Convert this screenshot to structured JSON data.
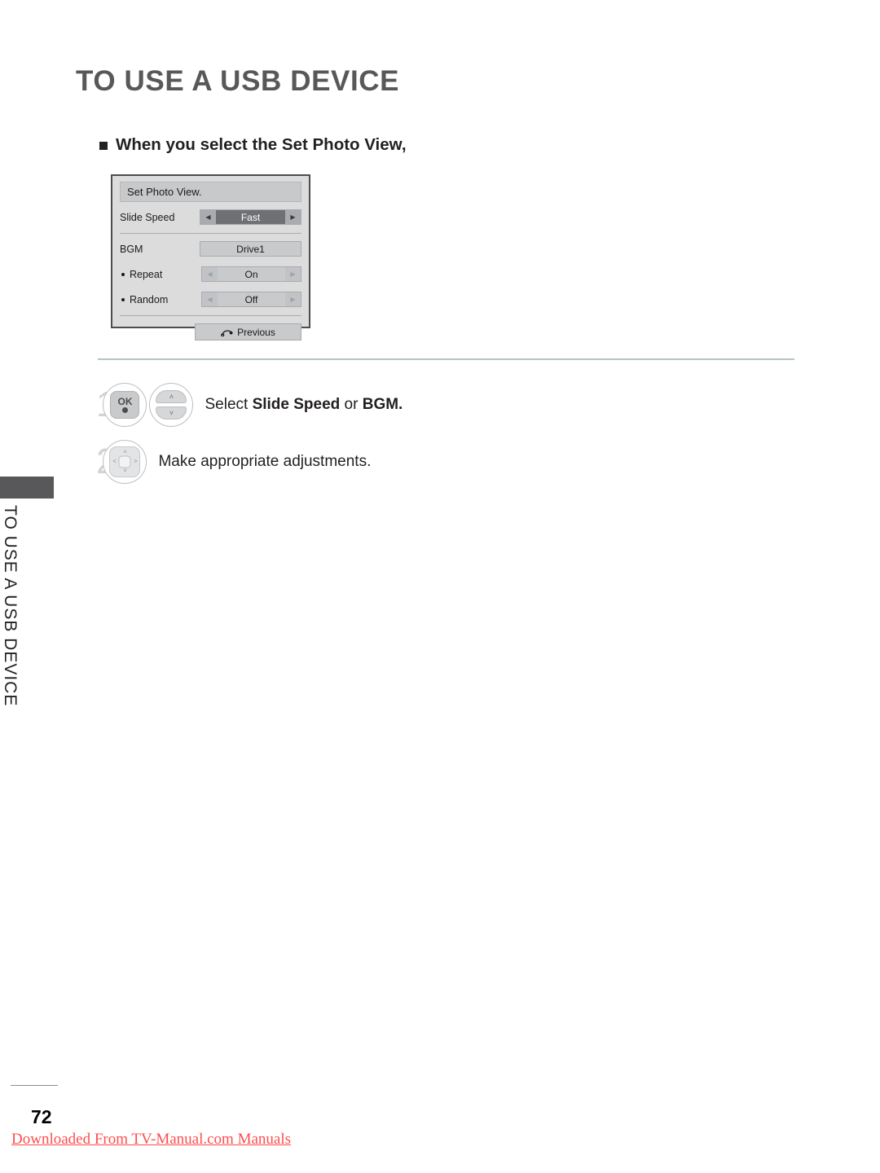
{
  "page": {
    "title": "TO USE A USB DEVICE",
    "subtitle": "When you select the Set Photo View,",
    "side_label": "TO USE A USB DEVICE",
    "number": "72",
    "watermark": "Downloaded From TV-Manual.com Manuals"
  },
  "osd": {
    "title": "Set Photo View.",
    "rows": [
      {
        "label": "Slide Speed",
        "value": "Fast",
        "type": "spinner",
        "selected": true,
        "left_arrow": "◀",
        "right_arrow": "▶"
      },
      {
        "label": "BGM",
        "value": "Drive1",
        "type": "box",
        "selected": false,
        "left_arrow": "",
        "right_arrow": ""
      },
      {
        "label": "Repeat",
        "value": "On",
        "type": "spinner",
        "selected": false,
        "left_arrow": "◀",
        "right_arrow": "▶"
      },
      {
        "label": "Random",
        "value": "Off",
        "type": "spinner",
        "selected": false,
        "left_arrow": "◀",
        "right_arrow": "▶"
      }
    ],
    "previous_label": "Previous",
    "previous_icon": "return-arrow-icon"
  },
  "steps": [
    {
      "number": "1",
      "keys": [
        "ok-button-icon",
        "up-down-arrows-icon"
      ],
      "ok_label": "OK",
      "up_chevron": "˄",
      "down_chevron": "˅",
      "text_parts": [
        {
          "text": "Select ",
          "bold": false
        },
        {
          "text": "Slide Speed",
          "bold": true
        },
        {
          "text": " or ",
          "bold": false
        },
        {
          "text": "BGM.",
          "bold": true
        }
      ]
    },
    {
      "number": "2",
      "keys": [
        "dpad-navigation-icon"
      ],
      "up_chevron": "˄",
      "down_chevron": "˅",
      "left_chevron": "˂",
      "right_chevron": "˃",
      "text_parts": [
        {
          "text": "Make appropriate adjustments.",
          "bold": false
        }
      ]
    }
  ],
  "colors": {
    "heading_gray": "#58585a",
    "osd_body": "#dcdcdc",
    "osd_border": "#4d4d4f",
    "highlight": "#6e7073",
    "divider": "#b6c3c6",
    "watermark_red": "#ff4d4d"
  }
}
